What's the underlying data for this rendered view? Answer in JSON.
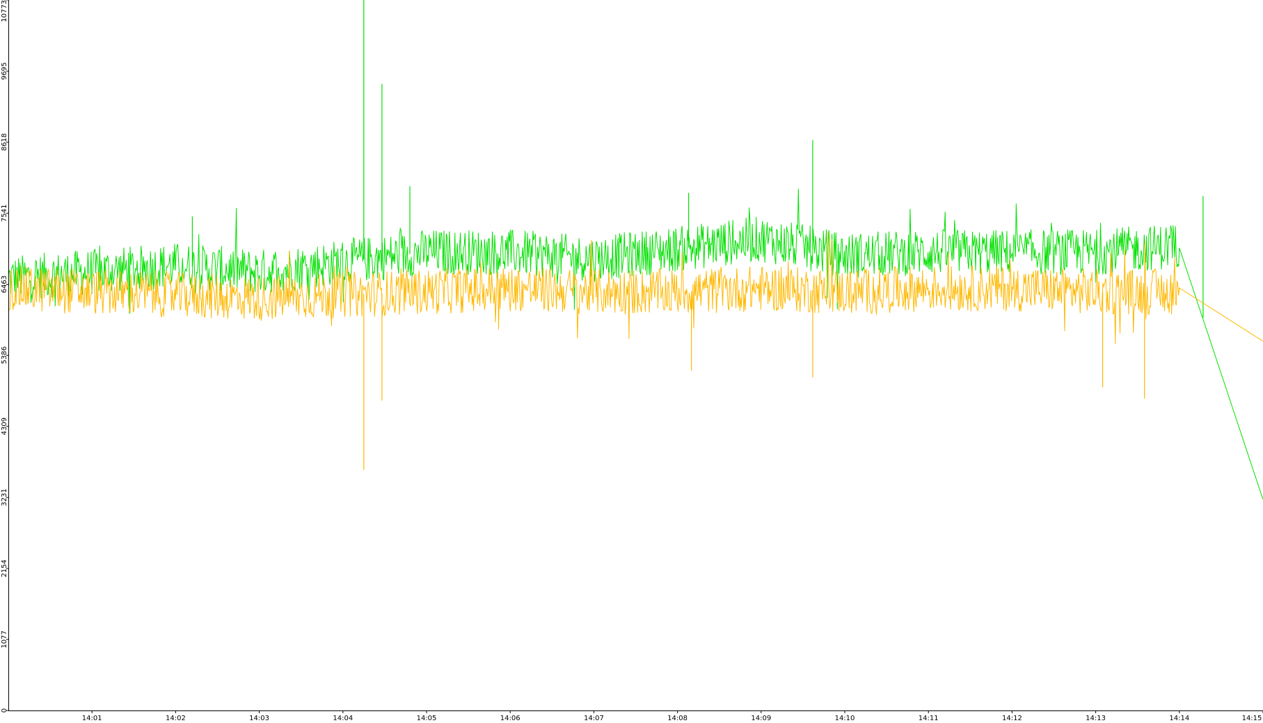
{
  "chart_data": {
    "type": "line",
    "title": "",
    "xlabel": "",
    "ylabel": "",
    "ylim": [
      0,
      10773
    ],
    "xlim": [
      "14:00",
      "14:15"
    ],
    "grid": false,
    "legend": "none",
    "y_ticks": [
      "0",
      "1077",
      "2154",
      "3231",
      "4309",
      "5386",
      "6463",
      "7541",
      "8618",
      "9695",
      "10773"
    ],
    "x_ticks": [
      "14:01",
      "14:02",
      "14:03",
      "14:04",
      "14:05",
      "14:06",
      "14:07",
      "14:08",
      "14:09",
      "14:10",
      "14:11",
      "14:12",
      "14:13",
      "14:14",
      "14:15"
    ],
    "series": [
      {
        "color": "#00e000",
        "x": [
          "14:00",
          "14:01",
          "14:02",
          "14:03",
          "14:04",
          "14:05",
          "14:06",
          "14:07",
          "14:08",
          "14:09",
          "14:10",
          "14:11",
          "14:12",
          "14:13",
          "14:14",
          "14:15"
        ],
        "values": [
          6550,
          6650,
          6750,
          6650,
          6800,
          6950,
          6950,
          6850,
          7000,
          7150,
          6900,
          6950,
          6950,
          6950,
          7050,
          3200
        ],
        "spikes": [
          {
            "x": "14:04:15",
            "value": 10773
          },
          {
            "x": "14:04:28",
            "value": 9500
          },
          {
            "x": "14:04:48",
            "value": 7950
          },
          {
            "x": "14:09:37",
            "value": 8650
          },
          {
            "x": "14:08:08",
            "value": 7850
          },
          {
            "x": "14:14:17",
            "value": 7800
          },
          {
            "x": "14:02:12",
            "value": 7490
          }
        ]
      },
      {
        "color": "#ffb800",
        "x": [
          "14:00",
          "14:01",
          "14:02",
          "14:03",
          "14:04",
          "14:05",
          "14:06",
          "14:07",
          "14:08",
          "14:09",
          "14:10",
          "14:11",
          "14:12",
          "14:13",
          "14:14",
          "14:15"
        ],
        "values": [
          6400,
          6350,
          6300,
          6250,
          6300,
          6350,
          6400,
          6350,
          6350,
          6400,
          6350,
          6400,
          6400,
          6350,
          6350,
          5600
        ],
        "spikes": [
          {
            "x": "14:04:15",
            "value": 3650
          },
          {
            "x": "14:04:28",
            "value": 4700
          },
          {
            "x": "14:13:05",
            "value": 4900
          },
          {
            "x": "14:13:35",
            "value": 4730
          },
          {
            "x": "14:08:10",
            "value": 5150
          },
          {
            "x": "14:09:37",
            "value": 5050
          }
        ]
      }
    ]
  }
}
